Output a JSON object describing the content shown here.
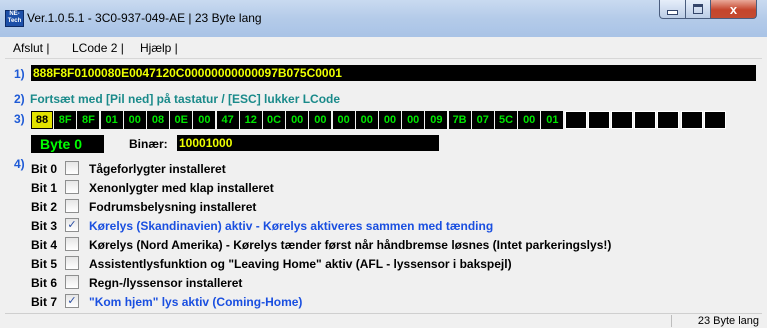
{
  "window": {
    "title": "Ver.1.0.5.1 -  3C0-937-049-AE | 23 Byte lang",
    "app_icon_text": "NE-Tech",
    "close_glyph": "x"
  },
  "menu": [
    "Afslut |",
    "LCode 2 |",
    "Hjælp |"
  ],
  "row_labels": [
    "1)",
    "2)",
    "3)",
    "4)"
  ],
  "line1": {
    "code": "888F8F0100080E0047120C00000000000097B075C0001"
  },
  "line2": {
    "hint": "Fortsæt med [Pil ned] på tastatur / [ESC] lukker LCode"
  },
  "bytes": {
    "values": [
      "88",
      "8F",
      "8F",
      "01",
      "00",
      "08",
      "0E",
      "00",
      "47",
      "12",
      "0C",
      "00",
      "00",
      "00",
      "00",
      "00",
      "00",
      "09",
      "7B",
      "07",
      "5C",
      "00",
      "01"
    ],
    "selected_index": 0,
    "empty_slots": 7
  },
  "byte_info": {
    "byte_label": "Byte 0",
    "binary_label": "Binær:",
    "binary_value": "10001000"
  },
  "bits": [
    {
      "name": "Bit 0",
      "checked": false,
      "desc": "Tågeforlygter installeret"
    },
    {
      "name": "Bit 1",
      "checked": false,
      "desc": "Xenonlygter med klap installeret"
    },
    {
      "name": "Bit 2",
      "checked": false,
      "desc": "Fodrumsbelysning installeret"
    },
    {
      "name": "Bit 3",
      "checked": true,
      "desc": "Kørelys (Skandinavien) aktiv - Kørelys aktiveres sammen med tænding"
    },
    {
      "name": "Bit 4",
      "checked": false,
      "desc": "Kørelys (Nord Amerika) - Kørelys tænder først når håndbremse løsnes (Intet parkeringslys!)"
    },
    {
      "name": "Bit 5",
      "checked": false,
      "desc": "Assistentlysfunktion og \"Leaving Home\" aktiv (AFL - lyssensor i bakspejl)"
    },
    {
      "name": "Bit 6",
      "checked": false,
      "desc": "Regn-/lyssensor installeret"
    },
    {
      "name": "Bit 7",
      "checked": true,
      "desc": "\"Kom hjem\" lys aktiv (Coming-Home)"
    }
  ],
  "status": {
    "text": "23 Byte lang"
  },
  "colors": {
    "code_text": "#ecff00",
    "byte_text": "#00e600",
    "selected_byte": "#e2e200",
    "row_number": "#1e5ad6",
    "hint_text": "#1a8a8a",
    "checked_desc": "#1a4fe0"
  }
}
